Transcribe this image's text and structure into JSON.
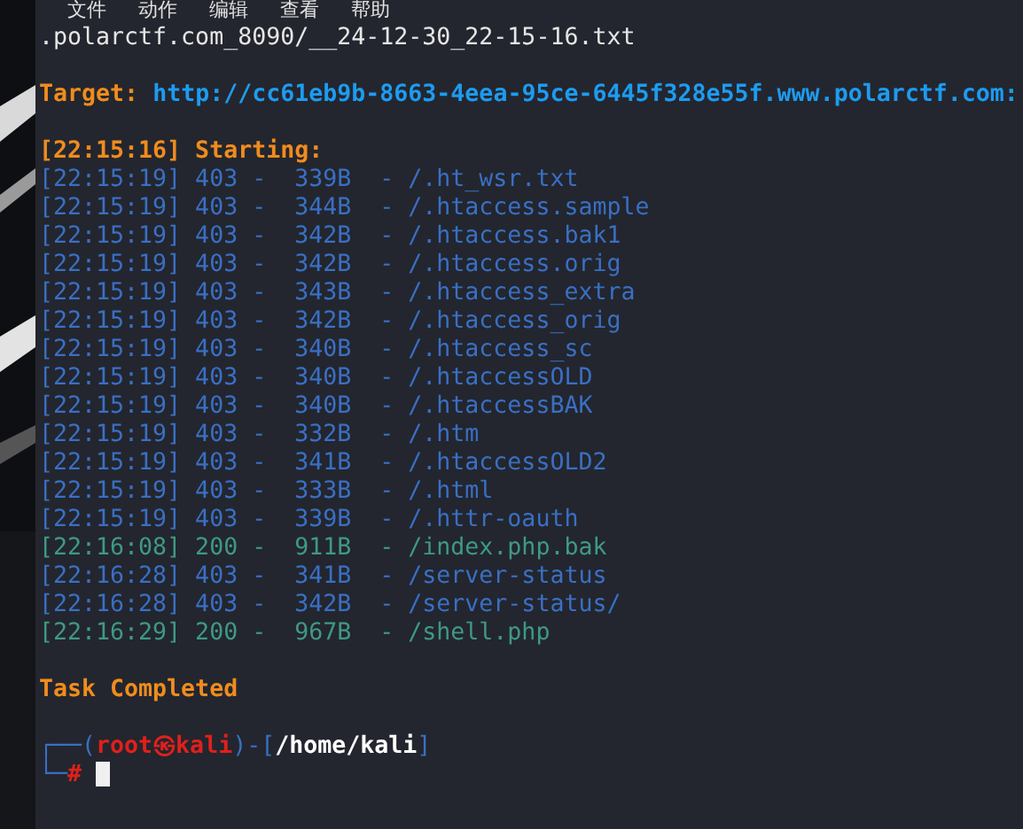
{
  "menu": [
    "文件",
    "动作",
    "编辑",
    "查看",
    "帮助"
  ],
  "file_line": ".polarctf.com_8090/__24-12-30_22-15-16.txt",
  "target": {
    "label": "Target:",
    "url": "http://cc61eb9b-8663-4eea-95ce-6445f328e55f.www.polarctf.com:"
  },
  "start": "[22:15:16] Starting:",
  "rows": [
    {
      "kind": "forbidden",
      "text": "[22:15:19] 403 -  339B  - /.ht_wsr.txt"
    },
    {
      "kind": "forbidden",
      "text": "[22:15:19] 403 -  344B  - /.htaccess.sample"
    },
    {
      "kind": "forbidden",
      "text": "[22:15:19] 403 -  342B  - /.htaccess.bak1"
    },
    {
      "kind": "forbidden",
      "text": "[22:15:19] 403 -  342B  - /.htaccess.orig"
    },
    {
      "kind": "forbidden",
      "text": "[22:15:19] 403 -  343B  - /.htaccess_extra"
    },
    {
      "kind": "forbidden",
      "text": "[22:15:19] 403 -  342B  - /.htaccess_orig"
    },
    {
      "kind": "forbidden",
      "text": "[22:15:19] 403 -  340B  - /.htaccess_sc"
    },
    {
      "kind": "forbidden",
      "text": "[22:15:19] 403 -  340B  - /.htaccessOLD"
    },
    {
      "kind": "forbidden",
      "text": "[22:15:19] 403 -  340B  - /.htaccessBAK"
    },
    {
      "kind": "forbidden",
      "text": "[22:15:19] 403 -  332B  - /.htm"
    },
    {
      "kind": "forbidden",
      "text": "[22:15:19] 403 -  341B  - /.htaccessOLD2"
    },
    {
      "kind": "forbidden",
      "text": "[22:15:19] 403 -  333B  - /.html"
    },
    {
      "kind": "forbidden",
      "text": "[22:15:19] 403 -  339B  - /.httr-oauth"
    },
    {
      "kind": "ok",
      "text": "[22:16:08] 200 -  911B  - /index.php.bak"
    },
    {
      "kind": "forbidden",
      "text": "[22:16:28] 403 -  341B  - /server-status"
    },
    {
      "kind": "forbidden",
      "text": "[22:16:28] 403 -  342B  - /server-status/"
    },
    {
      "kind": "ok",
      "text": "[22:16:29] 200 -  967B  - /shell.php"
    }
  ],
  "done": "Task Completed",
  "prompt": {
    "parts": [
      {
        "kind": "frame",
        "text": "┌──("
      },
      {
        "kind": "user",
        "text": "root㉿kali"
      },
      {
        "kind": "frame",
        "text": ")-["
      },
      {
        "kind": "dir",
        "text": "/home/kali"
      },
      {
        "kind": "frame",
        "text": "]"
      }
    ],
    "corner_bottom": "└─",
    "symbol": "#"
  }
}
